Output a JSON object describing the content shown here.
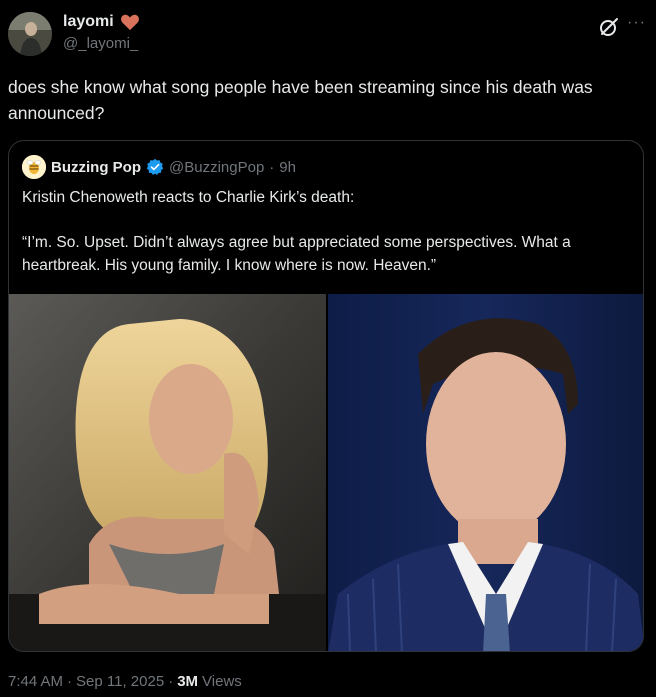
{
  "author": {
    "display_name": "layomi",
    "handle": "@_layomi_",
    "heart_icon": "heart-icon",
    "heart_color": "#d9725b"
  },
  "actions": {
    "grok_icon": "grok-icon",
    "more_label": "···"
  },
  "tweet": {
    "text": "does she know what song people have been streaming since his death was announced?"
  },
  "quote": {
    "display_name": "Buzzing Pop",
    "handle": "@BuzzingPop",
    "separator": "·",
    "time": "9h",
    "verified_color": "#1d9bf0",
    "paragraph_1": "Kristin Chenoweth reacts to Charlie Kirk’s death:",
    "paragraph_2": "“I’m. So. Upset. Didn’t always agree but appreciated some perspectives. What a heartbreak. His young family. I know where is now. Heaven.”",
    "media": [
      "woman-portrait-photo",
      "man-portrait-photo"
    ]
  },
  "footer": {
    "time": "7:44 AM",
    "dot1": "·",
    "date": "Sep 11, 2025",
    "dot2": "·",
    "views_count": "3M",
    "views_label": "Views"
  }
}
